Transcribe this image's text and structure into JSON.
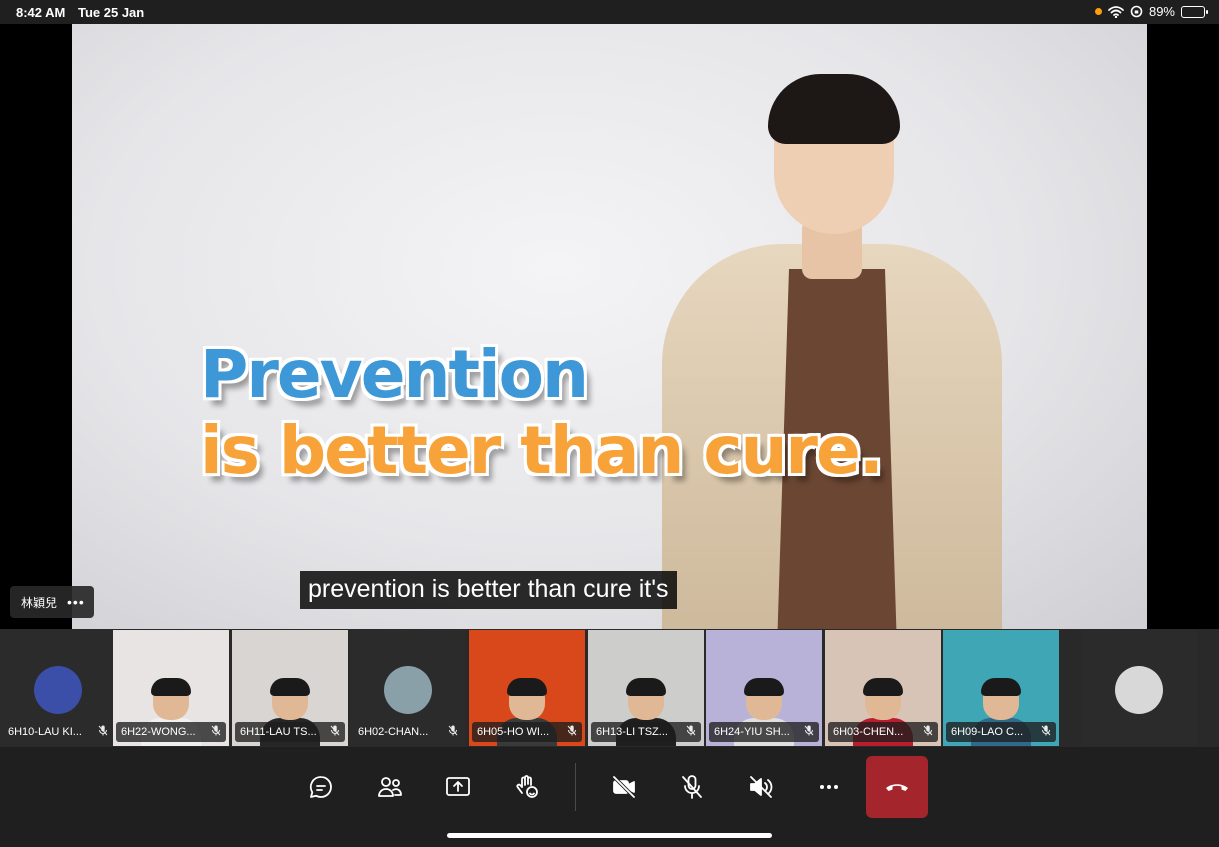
{
  "status_bar": {
    "time": "8:42 AM",
    "date": "Tue 25 Jan",
    "battery": "89%",
    "battery_level": 0.89
  },
  "video": {
    "headline_line1": "Prevention",
    "headline_line2": "is better than cure.",
    "caption": "prevention is better than cure it's"
  },
  "presenter_tag": {
    "name": "林穎兒",
    "more": "•••"
  },
  "participants": [
    {
      "name": "6H10-LAU KI...",
      "type": "avatar",
      "bg": "#3b4fa8"
    },
    {
      "name": "6H22-WONG...",
      "type": "video",
      "bg": "#e9e4e4"
    },
    {
      "name": "6H11-LAU TS...",
      "type": "video",
      "bg": "#d8d5d2"
    },
    {
      "name": "6H02-CHAN...",
      "type": "avatar",
      "bg": "#8aa0a8"
    },
    {
      "name": "6H05-HO WI...",
      "type": "video",
      "bg": "#d9481a"
    },
    {
      "name": "6H13-LI TSZ...",
      "type": "video",
      "bg": "#cdcdcb"
    },
    {
      "name": "6H24-YIU SH...",
      "type": "video",
      "bg": "#b9b2d8"
    },
    {
      "name": "6H03-CHEN...",
      "type": "video",
      "bg": "#d8c4b6"
    },
    {
      "name": "6H09-LAO C...",
      "type": "video",
      "bg": "#3fa6b6"
    },
    {
      "name": "",
      "type": "avatar",
      "bg": "#d8d8d8"
    }
  ],
  "controls": {
    "chat": "chat-icon",
    "people": "people-icon",
    "share": "share-screen-icon",
    "reactions": "raise-hand-icon",
    "camera": "camera-off-icon",
    "mic": "mic-off-icon",
    "speaker": "speaker-off-icon",
    "more": "more-icon",
    "leave": "hang-up-icon"
  },
  "colors": {
    "hangup": "#a4262c",
    "headline_blue": "#3e97d6",
    "headline_orange": "#f7a33a"
  }
}
